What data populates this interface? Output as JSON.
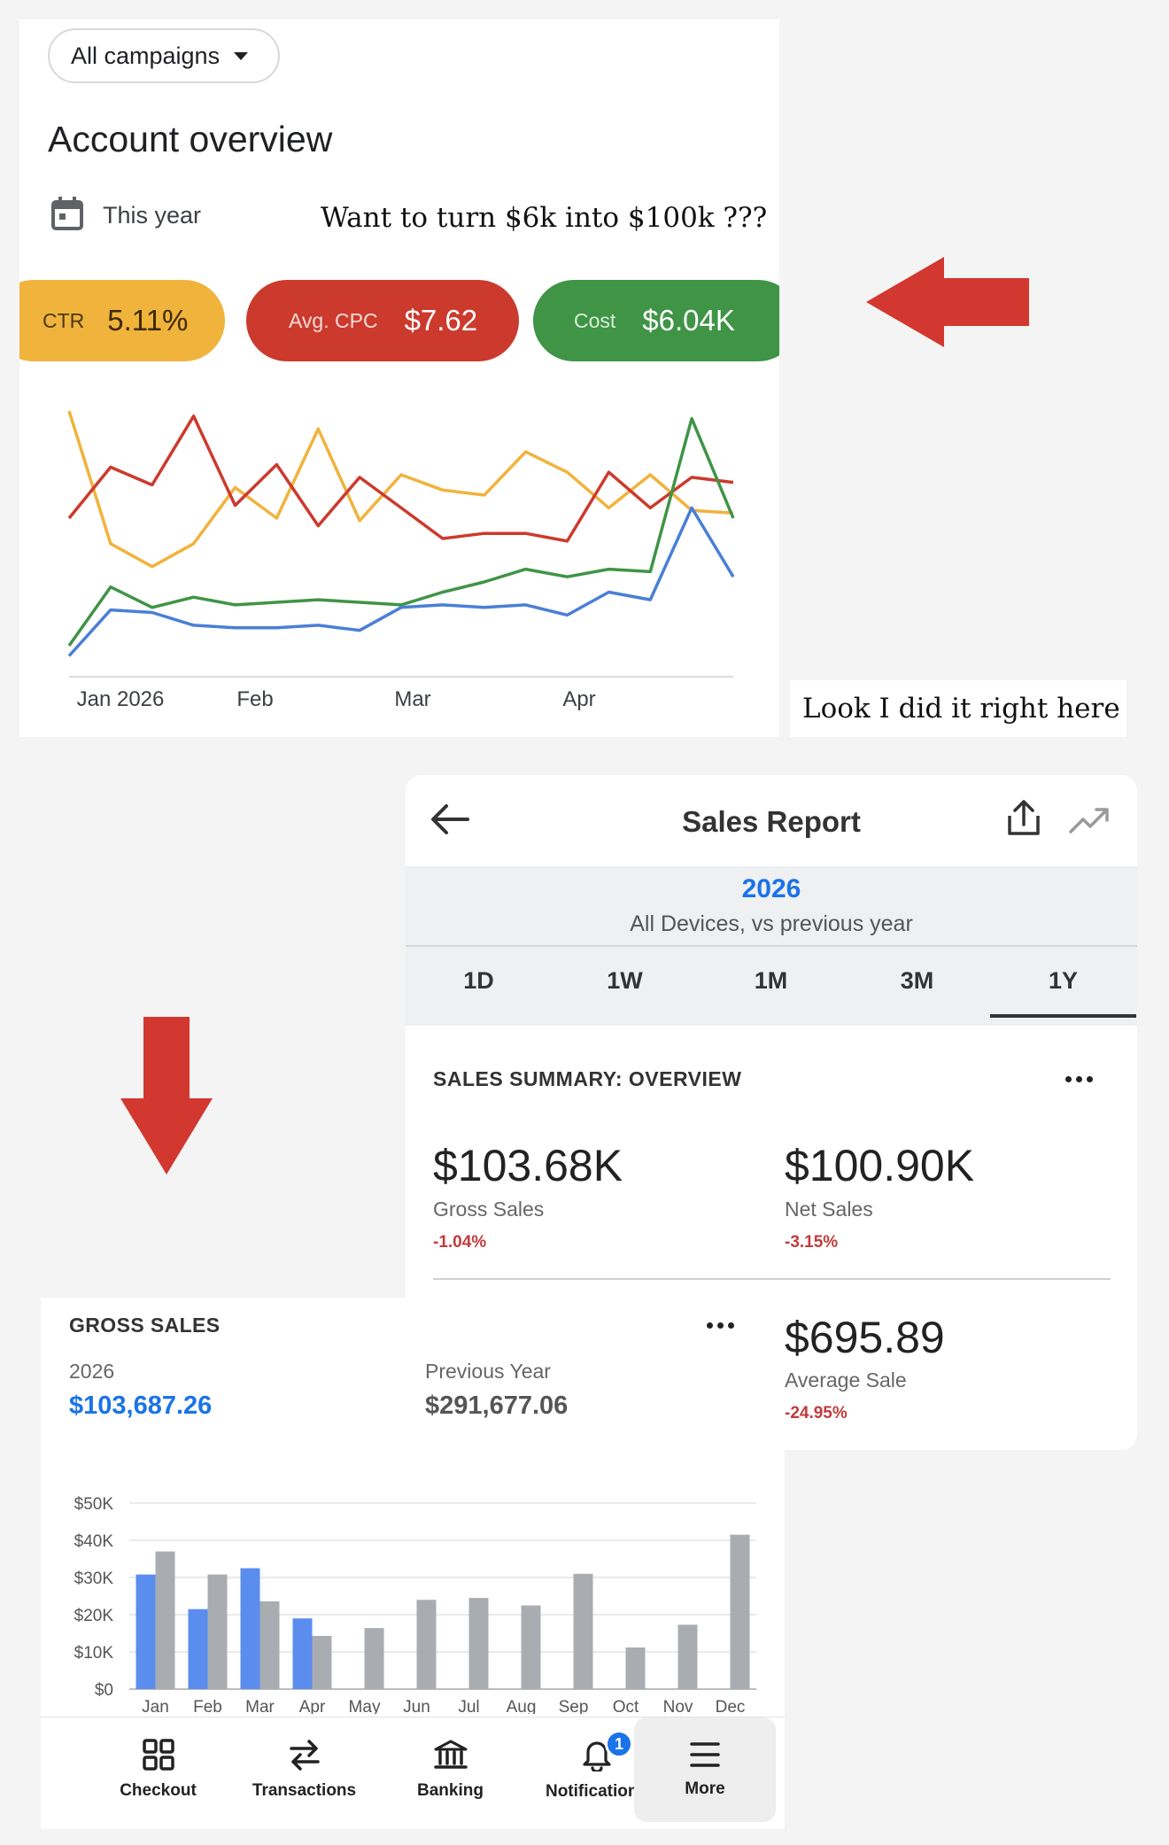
{
  "ads_panel": {
    "campaign_filter": "All campaigns",
    "title": "Account overview",
    "period": "This year",
    "overlay_note": "Want to turn $6k into $100k ???",
    "kpis": [
      {
        "label": "CTR",
        "value": "5.11%",
        "color": "#f0b33c"
      },
      {
        "label": "Avg. CPC",
        "value": "$7.62",
        "color": "#cc3a2d"
      },
      {
        "label": "Cost",
        "value": "$6.04K",
        "color": "#3f9446"
      }
    ],
    "side_note": "Look I did it right here"
  },
  "chart_data": [
    {
      "type": "line",
      "x_ticks": [
        "Jan 2026",
        "Feb",
        "Mar",
        "Apr"
      ],
      "grid": false,
      "series": [
        {
          "color": "#f0b33c",
          "values": [
            100,
            48,
            39,
            48,
            70,
            58,
            93,
            57,
            75,
            69,
            67,
            84,
            76,
            62,
            75,
            61,
            60
          ]
        },
        {
          "color": "#cc3a2d",
          "values": [
            58,
            78,
            71,
            98,
            63,
            79,
            55,
            74,
            62,
            50,
            52,
            52,
            49,
            76,
            62,
            74,
            72
          ]
        },
        {
          "color": "#3f9446",
          "values": [
            8,
            31,
            23,
            27,
            24,
            25,
            26,
            25,
            24,
            29,
            33,
            38,
            35,
            38,
            37,
            97,
            58
          ]
        },
        {
          "color": "#4a7fd6",
          "values": [
            4,
            22,
            21,
            16,
            15,
            15,
            16,
            14,
            23,
            24,
            23,
            24,
            20,
            29,
            26,
            62,
            35
          ]
        }
      ]
    },
    {
      "type": "bar",
      "categories": [
        "Jan",
        "Feb",
        "Mar",
        "Apr",
        "May",
        "Jun",
        "Jul",
        "Aug",
        "Sep",
        "Oct",
        "Nov",
        "Dec"
      ],
      "ylim": [
        0,
        50000
      ],
      "y_ticks": [
        "$0",
        "$10K",
        "$20K",
        "$30K",
        "$40K",
        "$50K"
      ],
      "grid": true,
      "series": [
        {
          "name": "2026",
          "color": "#5b8def",
          "values": [
            30800,
            21500,
            32500,
            19000,
            null,
            null,
            null,
            null,
            null,
            null,
            null,
            null
          ]
        },
        {
          "name": "Previous Year",
          "color": "#a9adb1",
          "values": [
            37000,
            30800,
            23600,
            14300,
            16400,
            24000,
            24500,
            22500,
            31000,
            11200,
            17300,
            41500
          ]
        }
      ]
    }
  ],
  "sales_report": {
    "title": "Sales Report",
    "year": "2026",
    "subtitle": "All Devices, vs previous year",
    "tabs": [
      "1D",
      "1W",
      "1M",
      "3M",
      "1Y"
    ],
    "active_tab": "1Y",
    "card_title": "SALES SUMMARY: OVERVIEW",
    "metrics": [
      {
        "value": "$103.68K",
        "label": "Gross Sales",
        "change": "-1.04%"
      },
      {
        "value": "$100.90K",
        "label": "Net Sales",
        "change": "-3.15%"
      },
      {
        "value": "$695.89",
        "label": "Average Sale",
        "change": "-24.95%"
      }
    ]
  },
  "gross_sales": {
    "title": "GROSS SALES",
    "current_label": "2026",
    "current_value": "$103,687.26",
    "previous_label": "Previous Year",
    "previous_value": "$291,677.06"
  },
  "bottom_nav": [
    {
      "label": "Checkout",
      "icon": "grid-icon"
    },
    {
      "label": "Transactions",
      "icon": "swap-icon"
    },
    {
      "label": "Banking",
      "icon": "bank-icon"
    },
    {
      "label": "Notifications",
      "icon": "bell-icon",
      "badge": "1"
    },
    {
      "label": "More",
      "icon": "menu-icon",
      "active": true
    }
  ]
}
